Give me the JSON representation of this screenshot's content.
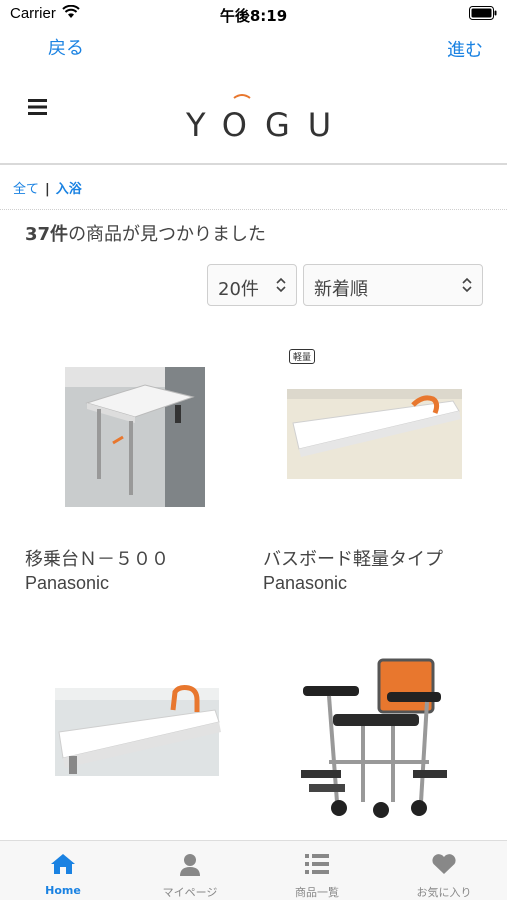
{
  "status_bar": {
    "carrier": "Carrier",
    "time": "午後8:19"
  },
  "nav": {
    "back_label": "戻る",
    "forward_label": "進む"
  },
  "header": {
    "logo_text": "YOGU"
  },
  "breadcrumb": {
    "items": [
      "全て",
      "入浴"
    ],
    "separator": "|"
  },
  "results": {
    "count": "37件",
    "suffix": "の商品が見つかりました"
  },
  "filters": {
    "per_page": "20件",
    "sort": "新着順"
  },
  "products": [
    {
      "name": "移乗台Ｎ－５００",
      "brand": "Panasonic",
      "badge": ""
    },
    {
      "name": "バスボード軽量タイプ",
      "brand": "Panasonic",
      "badge": "軽量"
    },
    {
      "name": "",
      "brand": "",
      "badge": ""
    },
    {
      "name": "",
      "brand": "",
      "badge": ""
    }
  ],
  "tab_bar": {
    "items": [
      {
        "label": "Home",
        "icon": "home-icon"
      },
      {
        "label": "マイページ",
        "icon": "user-icon"
      },
      {
        "label": "商品一覧",
        "icon": "list-icon"
      },
      {
        "label": "お気に入り",
        "icon": "heart-icon"
      }
    ]
  },
  "colors": {
    "accent": "#1a82e2",
    "tab_inactive": "#888888",
    "orange": "#e8772e"
  }
}
